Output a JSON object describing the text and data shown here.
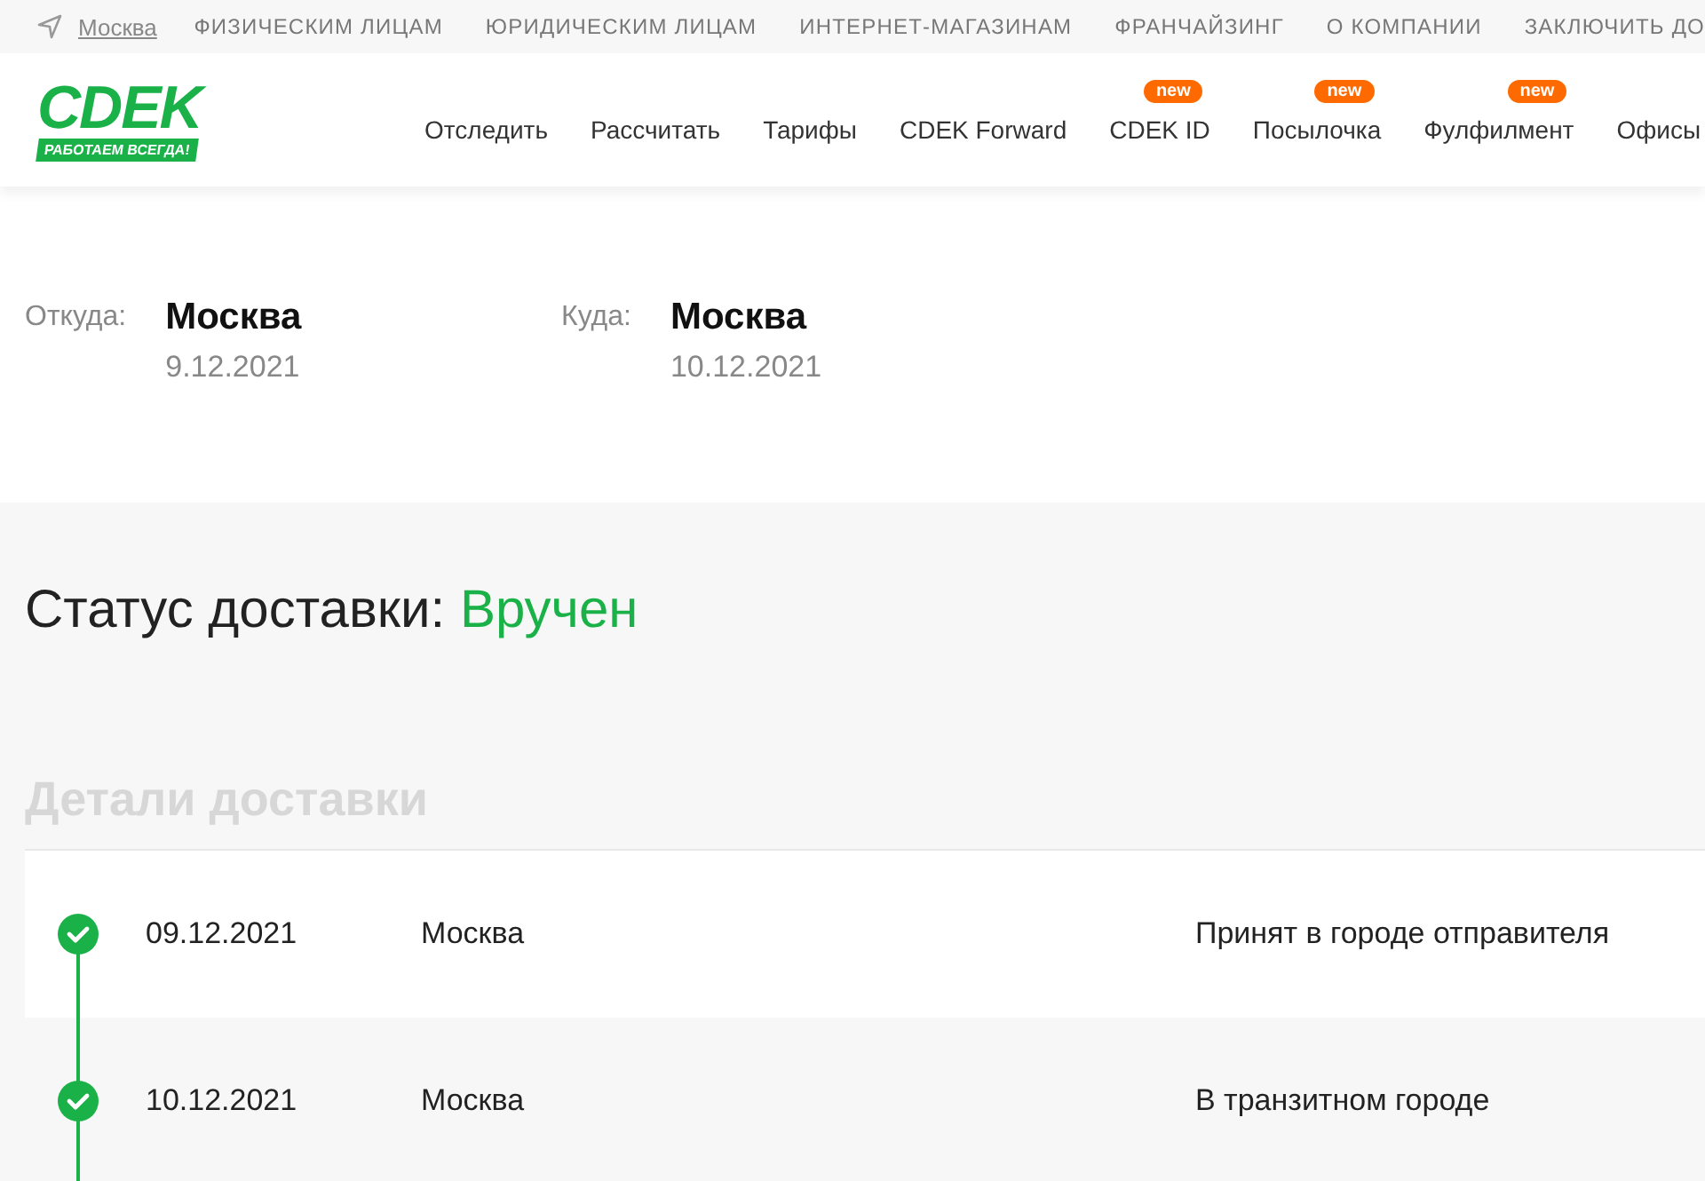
{
  "top_bar": {
    "city": "Москва",
    "links": [
      "ФИЗИЧЕСКИМ ЛИЦАМ",
      "ЮРИДИЧЕСКИМ ЛИЦАМ",
      "ИНТЕРНЕТ-МАГАЗИНАМ",
      "ФРАНЧАЙЗИНГ",
      "О КОМПАНИИ",
      "ЗАКЛЮЧИТЬ ДО"
    ]
  },
  "header": {
    "logo": {
      "name": "CDEK",
      "slogan": "РАБОТАЕМ ВСЕГДА!"
    },
    "nav": [
      {
        "label": "Отследить"
      },
      {
        "label": "Рассчитать"
      },
      {
        "label": "Тарифы"
      },
      {
        "label": "CDEK Forward"
      },
      {
        "label": "CDEK ID",
        "badge": "new"
      },
      {
        "label": "Посылочка",
        "badge": "new"
      },
      {
        "label": "Фулфилмент",
        "badge": "new"
      },
      {
        "label": "Офисы"
      }
    ]
  },
  "route": [
    {
      "label": "Откуда:",
      "city": "Москва",
      "date": "9.12.2021"
    },
    {
      "label": "Куда:",
      "city": "Москва",
      "date": "10.12.2021"
    }
  ],
  "status": {
    "label": "Статус доставки:",
    "value": "Вручен"
  },
  "details": {
    "title": "Детали доставки",
    "rows": [
      {
        "done": true,
        "date": "09.12.2021",
        "city": "Москва",
        "event": "Принят в городе отправителя"
      },
      {
        "done": true,
        "date": "10.12.2021",
        "city": "Москва",
        "event": "В транзитном городе"
      }
    ]
  }
}
